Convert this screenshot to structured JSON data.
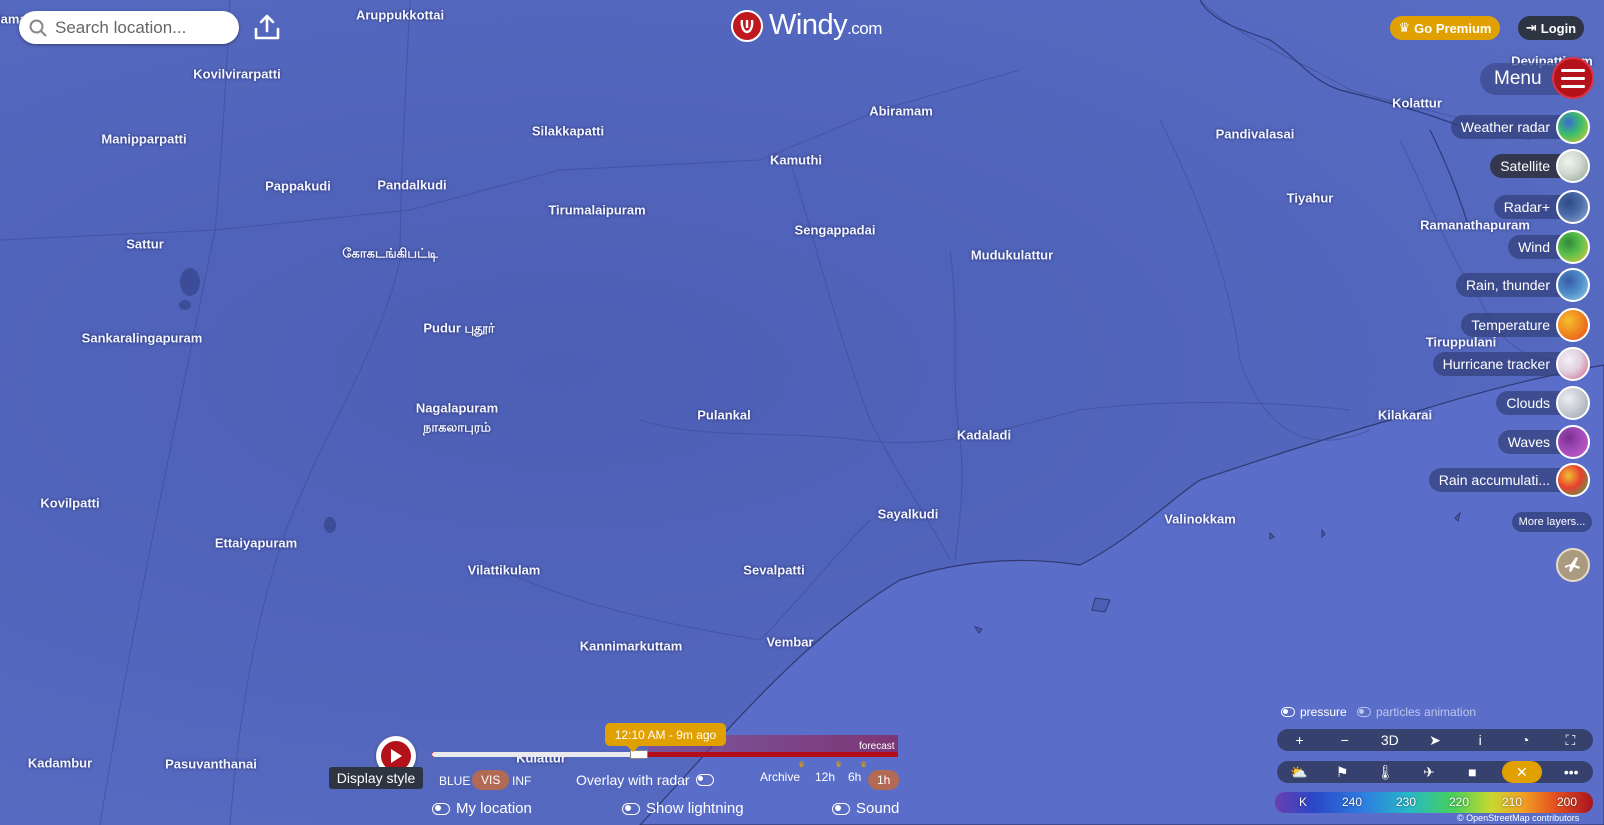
{
  "search": {
    "placeholder": "Search location..."
  },
  "logo": {
    "name": "Windy",
    "suffix": ".com"
  },
  "header": {
    "premium_label": "Go Premium",
    "login_label": "Login"
  },
  "menu": {
    "label": "Menu"
  },
  "layers": [
    {
      "label": "Weather radar",
      "colors": [
        "#3bbf6a",
        "#e3c82a",
        "#3a6ad0"
      ]
    },
    {
      "label": "Satellite",
      "colors": [
        "#d0d8d0",
        "#8aa090",
        "#eef2ee"
      ]
    },
    {
      "label": "Radar+",
      "colors": [
        "#4a6aa8",
        "#9ab0d0",
        "#2d4a88"
      ]
    },
    {
      "label": "Wind",
      "colors": [
        "#5bc04c",
        "#e9c640",
        "#2f8a3a"
      ]
    },
    {
      "label": "Rain, thunder",
      "colors": [
        "#4c8ac8",
        "#9ad0e8",
        "#3a5aa8"
      ]
    },
    {
      "label": "Temperature",
      "colors": [
        "#f08a20",
        "#e84a20",
        "#f4c030"
      ]
    },
    {
      "label": "Hurricane tracker",
      "colors": [
        "#e0d0e0",
        "#d06080",
        "#f4f0f4"
      ]
    },
    {
      "label": "Clouds",
      "colors": [
        "#c8ccd4",
        "#9aa0ac",
        "#eceef2"
      ]
    },
    {
      "label": "Waves",
      "colors": [
        "#a04ab8",
        "#d060c8",
        "#7a3090"
      ]
    },
    {
      "label": "Rain accumulati...",
      "colors": [
        "#e84030",
        "#3ab050",
        "#f0c030"
      ]
    }
  ],
  "more_layers_label": "More layers...",
  "map_toggles": {
    "pressure": "pressure",
    "particles": "particles animation"
  },
  "controls_row1": [
    "+",
    "−",
    "3D",
    "➤",
    "i",
    "◔",
    "⛶"
  ],
  "controls_row2_icons": [
    "weather-icon",
    "flag-icon",
    "thermometer-icon",
    "plane-icon",
    "camera-icon",
    "close-icon",
    "more-icon"
  ],
  "legend": {
    "unit": "K",
    "ticks": [
      "240",
      "230",
      "220",
      "210",
      "200"
    ]
  },
  "attribution": "© OpenStreetMap contributors",
  "timeline": {
    "current_time": "12:10 AM - 9m ago",
    "forecast_label": "forecast",
    "display_style_label": "Display style",
    "options": [
      "BLUE",
      "VIS",
      "INF"
    ],
    "selected_option": "VIS",
    "overlay_label": "Overlay with radar",
    "archive": [
      "Archive",
      "12h",
      "6h",
      "1h"
    ],
    "archive_selected": "1h"
  },
  "bottom_toggles": {
    "my_location": "My location",
    "lightning": "Show lightning",
    "sound": "Sound"
  },
  "places": [
    {
      "name": "Aruppukkottai"
    },
    {
      "name": "Kovilvirarpatti"
    },
    {
      "name": "Manipparpatti"
    },
    {
      "name": "Pappakudi"
    },
    {
      "name": "Pandalkudi"
    },
    {
      "name": "Silakkapatti"
    },
    {
      "name": "Abiramam"
    },
    {
      "name": "Kamuthi"
    },
    {
      "name": "Tirumalaipuram"
    },
    {
      "name": "Sengappadai"
    },
    {
      "name": "Mudukulattur"
    },
    {
      "name": "Sattur"
    },
    {
      "name": "கோகடங்கிபட்டி"
    },
    {
      "name": "Sankaralingapuram"
    },
    {
      "name": "Pudur புதூர்"
    },
    {
      "name": "Nagalapuram"
    },
    {
      "name": "நாகலாபுரம்"
    },
    {
      "name": "Pulankal"
    },
    {
      "name": "Kadaladi"
    },
    {
      "name": "Kovilpatti"
    },
    {
      "name": "Ettaiyapuram"
    },
    {
      "name": "Sayalkudi"
    },
    {
      "name": "Valinokkam"
    },
    {
      "name": "Vilattikulam"
    },
    {
      "name": "Sevalpatti"
    },
    {
      "name": "Kannimarkuttam"
    },
    {
      "name": "Vembar"
    },
    {
      "name": "Kadambur"
    },
    {
      "name": "Pasuvanthanai"
    },
    {
      "name": "Kulattur"
    },
    {
      "name": "Pandivalasai"
    },
    {
      "name": "Kolattur"
    },
    {
      "name": "Tiyahur"
    },
    {
      "name": "Ramanathapuram"
    },
    {
      "name": "Tiruppulani"
    },
    {
      "name": "Kilakarai"
    },
    {
      "name": "Devipattinam"
    },
    {
      "name": "Ilama"
    }
  ]
}
